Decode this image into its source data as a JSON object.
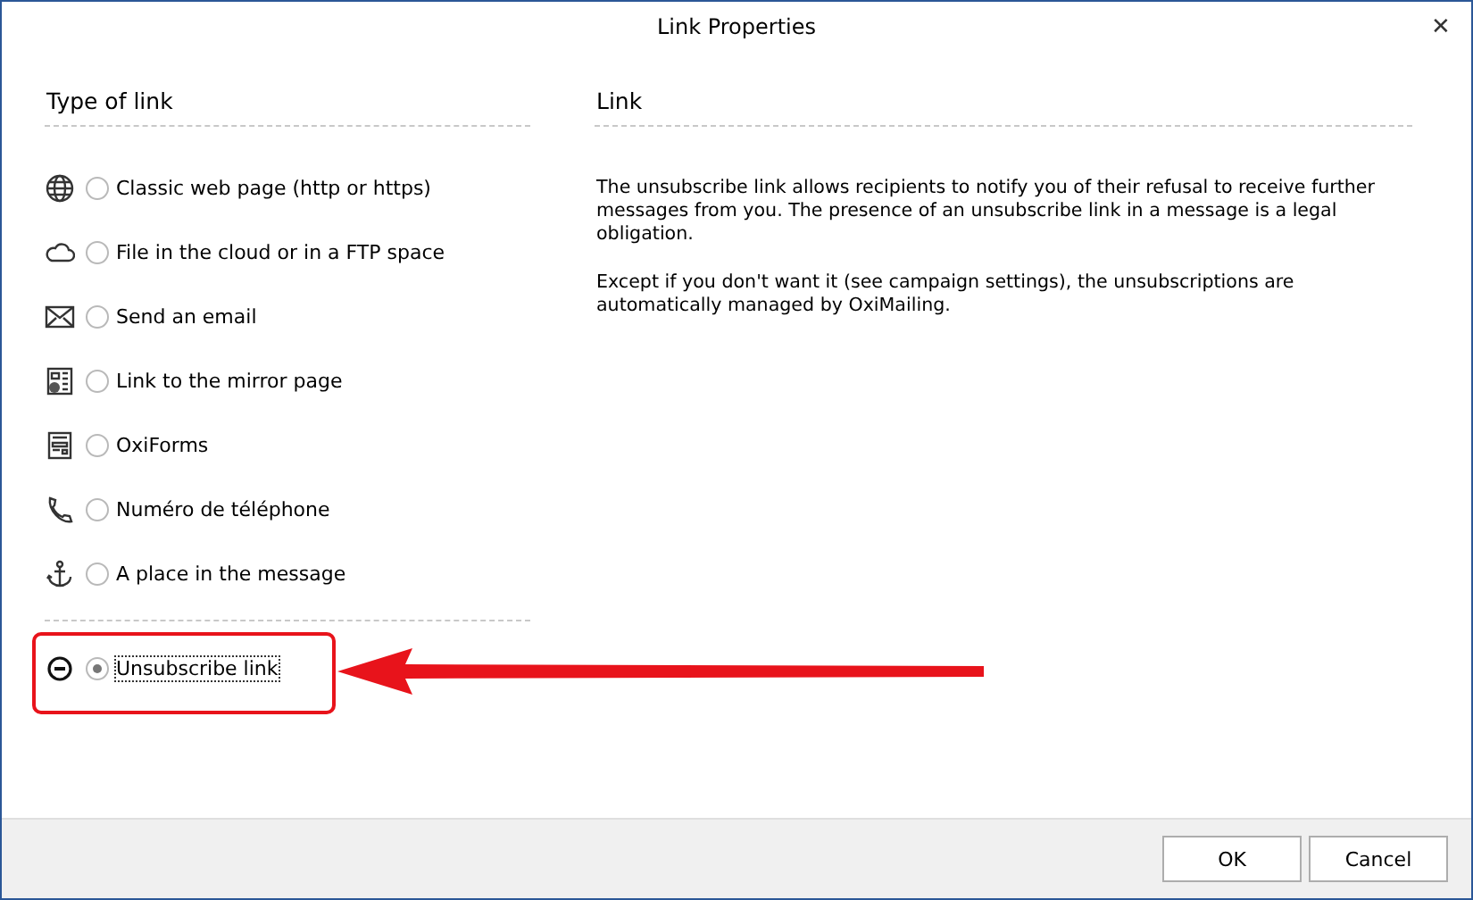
{
  "window": {
    "title": "Link Properties",
    "close": "✕"
  },
  "type_section": {
    "heading": "Type of link",
    "options": [
      {
        "kind": "web",
        "label": "Classic web page (http or https)",
        "selected": false
      },
      {
        "kind": "cloud",
        "label": "File in the cloud or in a FTP space",
        "selected": false
      },
      {
        "kind": "email",
        "label": "Send an email",
        "selected": false
      },
      {
        "kind": "mirror",
        "label": "Link to the mirror page",
        "selected": false
      },
      {
        "kind": "form",
        "label": "OxiForms",
        "selected": false
      },
      {
        "kind": "phone",
        "label": "Numéro de téléphone",
        "selected": false
      },
      {
        "kind": "anchor",
        "label": "A place in the message",
        "selected": false
      }
    ],
    "special_options": [
      {
        "kind": "unsubscribe",
        "label": "Unsubscribe link",
        "selected": true
      }
    ]
  },
  "link_section": {
    "heading": "Link",
    "paragraphs": [
      "The unsubscribe link allows recipients to notify you of their refusal to receive further messages from you. The presence of an unsubscribe link in a message is a legal obligation.",
      "Except if you don't want it (see campaign settings), the unsubscriptions are automatically managed by OxiMailing."
    ]
  },
  "buttons": [
    "OK",
    "Cancel"
  ]
}
